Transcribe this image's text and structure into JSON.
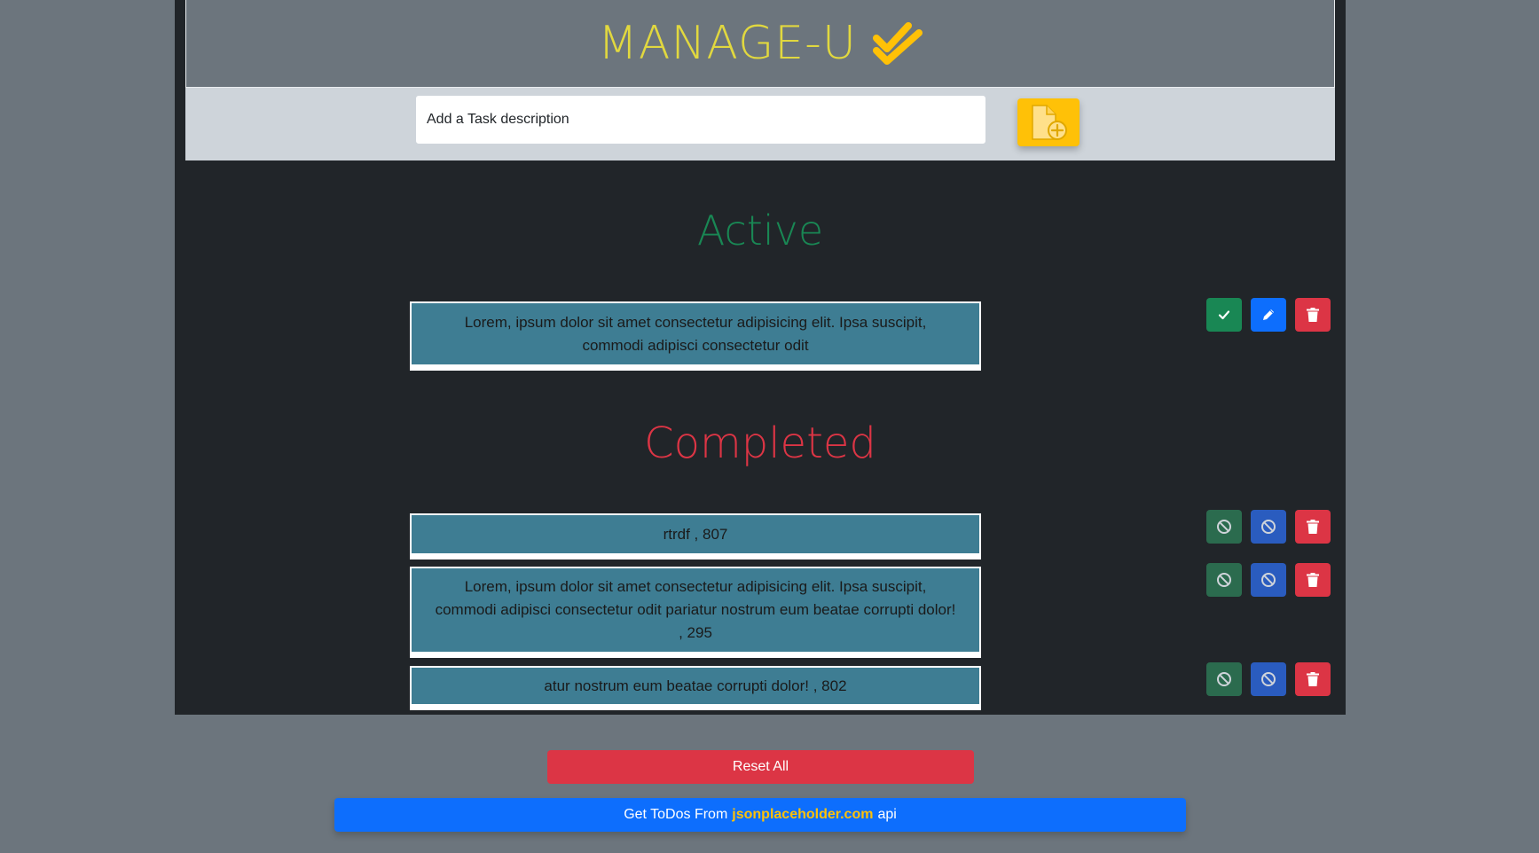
{
  "brand": {
    "title": "MANAGE-U",
    "icon": "double-check-icon",
    "title_color": "#e1d83f",
    "icon_color": "#ffc107"
  },
  "task_input": {
    "placeholder": "Add a Task description",
    "value": ""
  },
  "add_button": {
    "icon": "file-plus-icon"
  },
  "active": {
    "title": "Active",
    "color": "#198754",
    "tasks": [
      {
        "text": "Lorem, ipsum dolor sit amet consectetur adipisicing elit. Ipsa suscipit, commodi adipisci consectetur odit",
        "actions": [
          "check-icon",
          "pencil-icon",
          "trash-icon"
        ]
      }
    ]
  },
  "completed": {
    "title": "Completed",
    "color": "#dc3545",
    "tasks": [
      {
        "text": "rtrdf , 807",
        "actions": [
          "ban-icon",
          "ban-icon",
          "trash-icon"
        ]
      },
      {
        "text": "Lorem, ipsum dolor sit amet consectetur adipisicing elit. Ipsa suscipit, commodi adipisci consectetur odit pariatur nostrum eum beatae corrupti dolor! , 295",
        "actions": [
          "ban-icon",
          "ban-icon",
          "trash-icon"
        ]
      },
      {
        "text": "atur nostrum eum beatae corrupti dolor! , 802",
        "actions": [
          "ban-icon",
          "ban-icon",
          "trash-icon"
        ]
      }
    ]
  },
  "reset": {
    "label": "Reset All"
  },
  "fetch": {
    "prefix": "Get ToDos From",
    "link": "jsonplaceholder.com",
    "suffix": "api"
  },
  "colors": {
    "page_bg": "#6c757d",
    "app_bg": "#212529",
    "card_bg": "#3e7d93",
    "success": "#198754",
    "primary": "#0d6efd",
    "danger": "#dc3545",
    "warning": "#ffc107"
  }
}
